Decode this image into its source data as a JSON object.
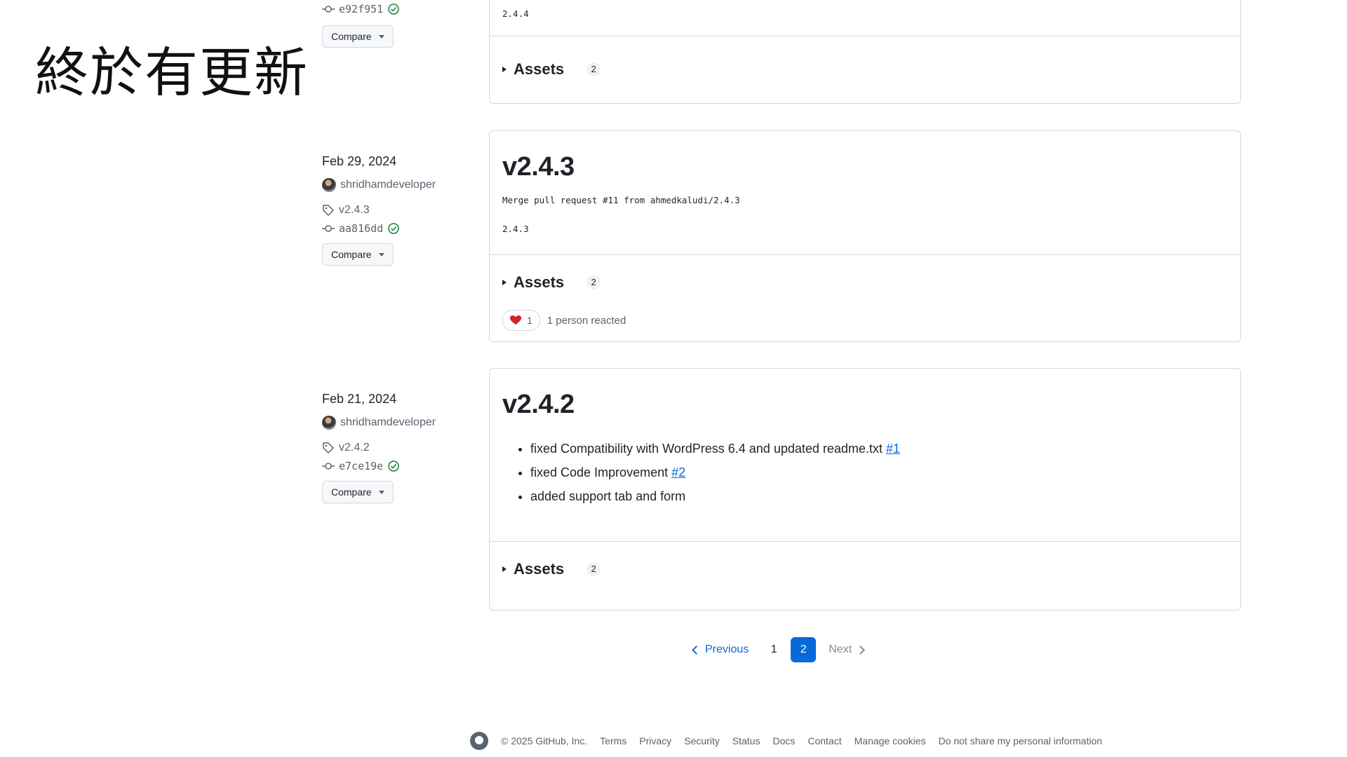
{
  "overlay": {
    "title": "終於有更新"
  },
  "releases": [
    {
      "commit": "e92f951",
      "compare_label": "Compare",
      "body_text": "2.4.4",
      "assets_label": "Assets",
      "assets_count": "2"
    },
    {
      "date": "Feb 29, 2024",
      "author": "shridhamdeveloper",
      "tag": "v2.4.3",
      "commit": "aa816dd",
      "compare_label": "Compare",
      "title": "v2.4.3",
      "commit_message": "Merge pull request #11 from ahmedkaludi/2.4.3",
      "body_text": "2.4.3",
      "assets_label": "Assets",
      "assets_count": "2",
      "reaction_count": "1",
      "reaction_text": "1 person reacted"
    },
    {
      "date": "Feb 21, 2024",
      "author": "shridhamdeveloper",
      "tag": "v2.4.2",
      "commit": "e7ce19e",
      "compare_label": "Compare",
      "title": "v2.4.2",
      "notes": [
        {
          "text": "fixed Compatibility with WordPress 6.4 and updated readme.txt ",
          "link": "#1"
        },
        {
          "text": "fixed Code Improvement ",
          "link": "#2"
        },
        {
          "text": "added support tab and form",
          "link": ""
        }
      ],
      "assets_label": "Assets",
      "assets_count": "2"
    }
  ],
  "pagination": {
    "previous": "Previous",
    "pages": [
      "1",
      "2"
    ],
    "current": "2",
    "next": "Next"
  },
  "footer": {
    "copyright": "© 2025 GitHub, Inc.",
    "links": [
      "Terms",
      "Privacy",
      "Security",
      "Status",
      "Docs",
      "Contact",
      "Manage cookies",
      "Do not share my personal information"
    ]
  },
  "colors": {
    "link": "#0969da",
    "border": "#d1d9e0",
    "verified": "#1a7f37",
    "heart": "#cf222e"
  }
}
